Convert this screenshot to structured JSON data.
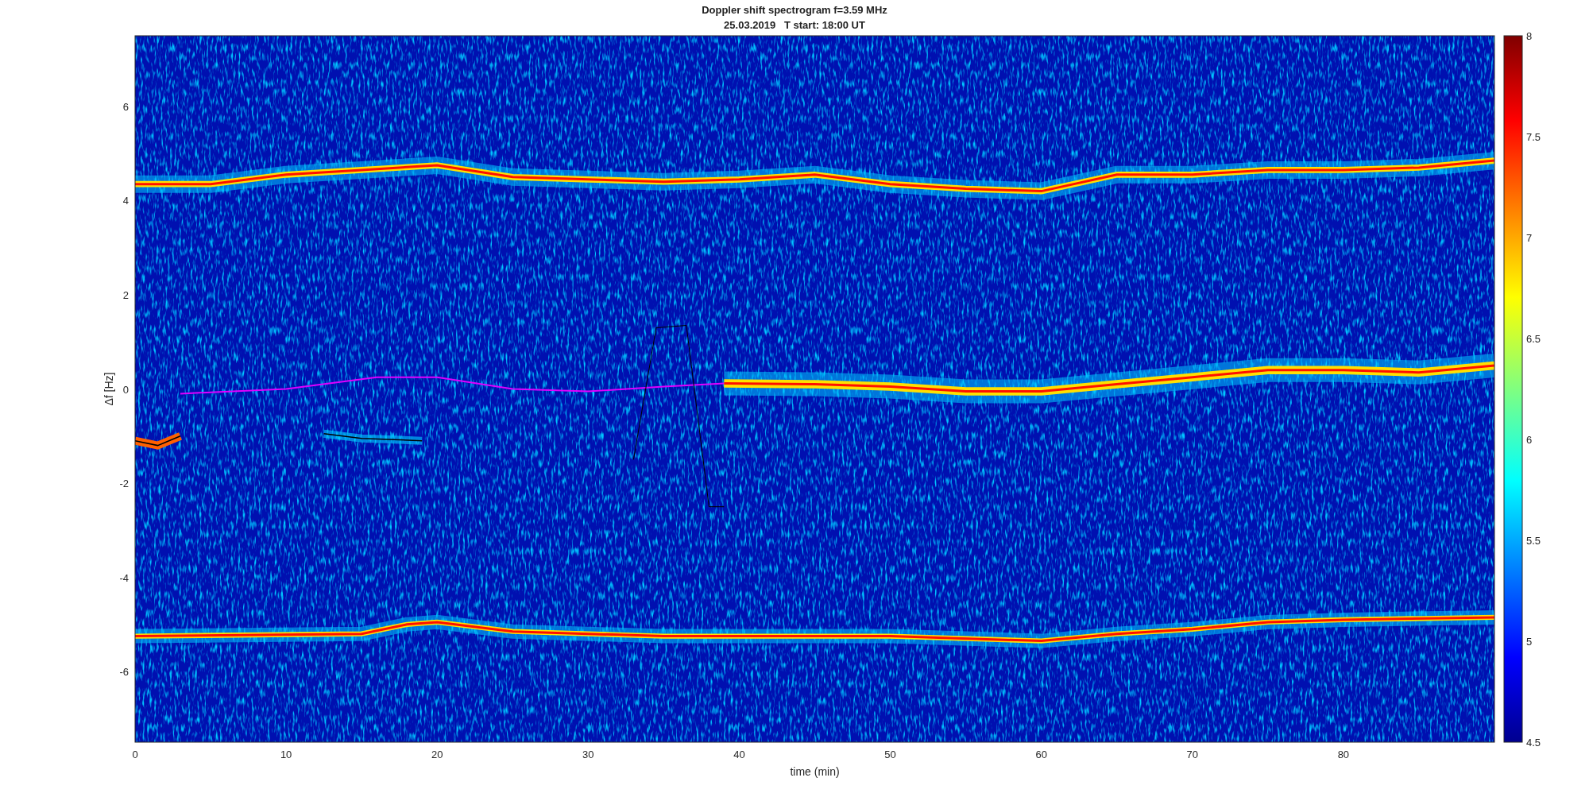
{
  "title": {
    "line_1": "Doppler shift spectrogram f=3.59 MHz",
    "line_2": "25.03.2019   T start: 18:00 UT"
  },
  "plot": {
    "ylabel": "Δf [Hz]",
    "xlabel": "time (min)",
    "xticks": [
      "0",
      "10",
      "20",
      "30",
      "40",
      "50",
      "60",
      "70",
      "80"
    ],
    "yticks": [
      "6",
      "4",
      "2",
      "0",
      "-2",
      "-4",
      "-6"
    ]
  },
  "colorbar": {
    "ticks": [
      "8",
      "7.5",
      "7",
      "6.5",
      "6",
      "5.5",
      "5",
      "4.5"
    ]
  }
}
